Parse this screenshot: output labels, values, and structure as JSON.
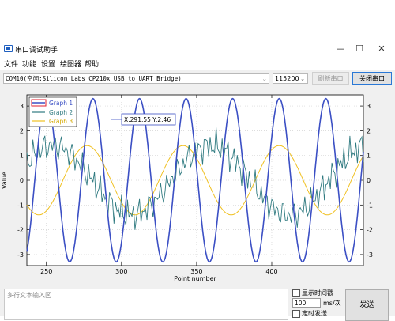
{
  "window": {
    "title": "串口调试助手",
    "controls": {
      "minimize": "—",
      "maximize": "☐",
      "close": "✕"
    }
  },
  "menu": [
    "文件",
    "功能",
    "设置",
    "绘图器",
    "帮助"
  ],
  "toolbar": {
    "port_value": "COM10(空闲:Silicon Labs CP210x USB to UART Bridge)",
    "baud_value": "115200",
    "refresh_label": "刷新串口",
    "close_port_label": "关闭串口"
  },
  "chart_data": {
    "type": "line",
    "xlabel": "Point number",
    "ylabel": "Value",
    "xlim": [
      237,
      461
    ],
    "ylim": [
      -3.45,
      3.45
    ],
    "xticks": [
      250,
      300,
      350,
      400
    ],
    "yticks": [
      3,
      2,
      1,
      0,
      -1,
      -2,
      -3
    ],
    "legend": {
      "placement": "top-left",
      "entries": [
        "Graph 1",
        "Graph 2",
        "Graph 3"
      ]
    },
    "tooltip": "X:291.55 Y:2.46",
    "series": [
      {
        "name": "Graph 1",
        "color": "#3b4fc4",
        "description": "sine",
        "amplitude": 3.3,
        "period": 31,
        "phase_x": 281
      },
      {
        "name": "Graph 2",
        "color": "#2f7a80",
        "description": "noisy",
        "amplitude": 1.4,
        "period": 105
      },
      {
        "name": "Graph 3",
        "color": "#f0c020",
        "description": "sine",
        "amplitude": 1.4,
        "period": 64,
        "phase_x": 277
      }
    ]
  },
  "bottom": {
    "send_placeholder": "多行文本输入区",
    "show_time_label": "显示时间戳",
    "interval_value": "100",
    "interval_unit": "ms/次",
    "timed_send_label": "定时发送",
    "send_label": "发送"
  }
}
